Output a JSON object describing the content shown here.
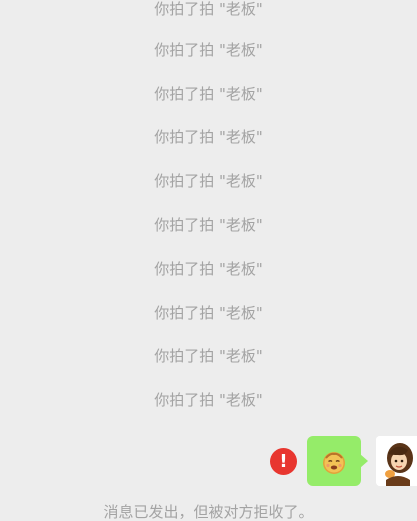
{
  "chat": {
    "pat_notices": [
      "你拍了拍 \"老板\"",
      "你拍了拍 \"老板\"",
      "你拍了拍 \"老板\"",
      "你拍了拍 \"老板\"",
      "你拍了拍 \"老板\"",
      "你拍了拍 \"老板\"",
      "你拍了拍 \"老板\"",
      "你拍了拍 \"老板\"",
      "你拍了拍 \"老板\"",
      "你拍了拍 \"老板\""
    ],
    "outgoing_message": {
      "type": "sticker",
      "icon": "emoji-face-sticker-icon",
      "status_icon": "error-exclamation-icon",
      "bubble_color": "#95ec69",
      "error_color": "#e8362f"
    },
    "rejected_notice": "消息已发出，但被对方拒收了。"
  }
}
